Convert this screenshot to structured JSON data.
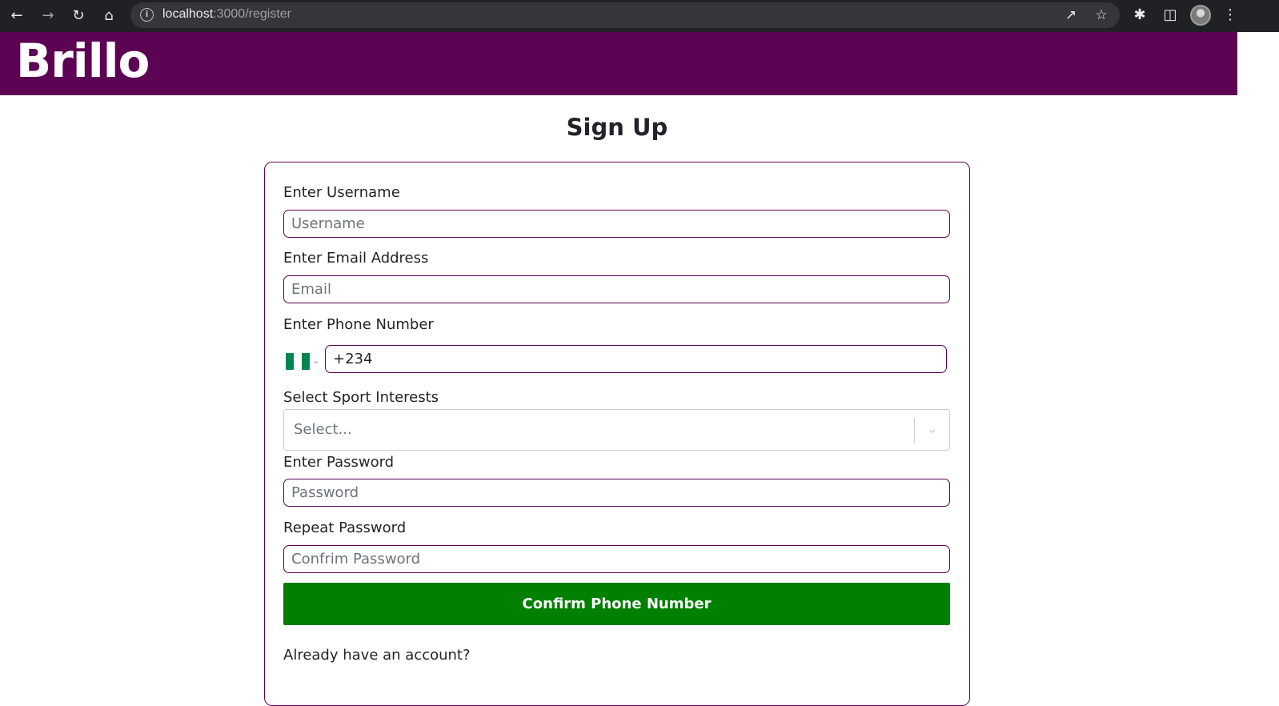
{
  "browser": {
    "url_host": "localhost",
    "url_path": ":3000/register"
  },
  "header": {
    "brand": "Brillo",
    "brand_color": "#5c0354"
  },
  "page": {
    "title": "Sign Up"
  },
  "form": {
    "username": {
      "label": "Enter Username",
      "placeholder": "Username"
    },
    "email": {
      "label": "Enter Email Address",
      "placeholder": "Email"
    },
    "phone": {
      "label": "Enter Phone Number",
      "value": "+234",
      "country_flag": "nigeria-flag-icon"
    },
    "sports": {
      "label": "Select Sport Interests",
      "placeholder": "Select..."
    },
    "password": {
      "label": "Enter Password",
      "placeholder": "Password"
    },
    "repeat_password": {
      "label": "Repeat Password",
      "placeholder": "Confrim Password"
    },
    "submit_label": "Confirm Phone Number",
    "submit_color": "#008000",
    "footer_text": "Already have an account?"
  }
}
